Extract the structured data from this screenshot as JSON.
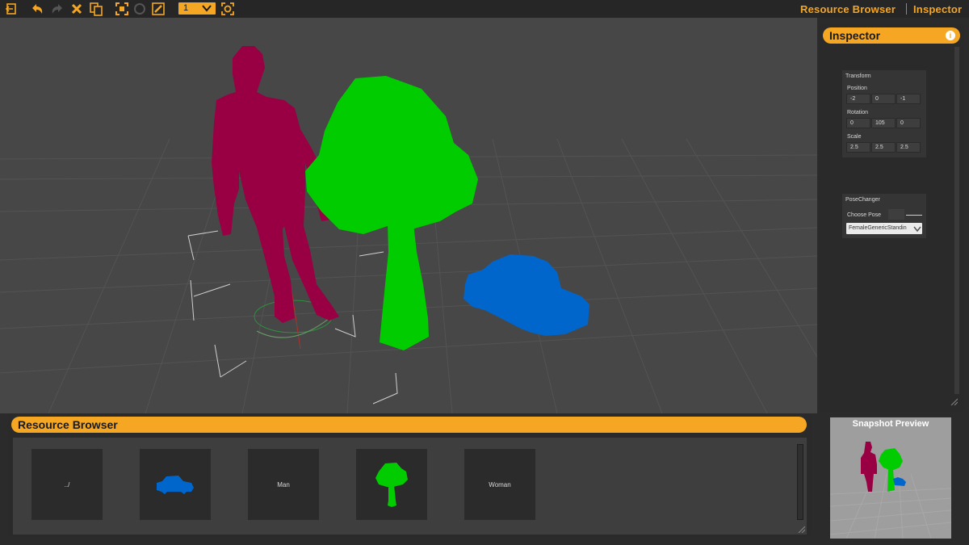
{
  "toolbar": {
    "selector_value": "1",
    "right_links": [
      "Resource Browser",
      "Inspector"
    ]
  },
  "inspector": {
    "title": "Inspector",
    "transform": {
      "title": "Transform",
      "position_label": "Position",
      "position": [
        "-2",
        "0",
        "-1"
      ],
      "rotation_label": "Rotation",
      "rotation": [
        "0",
        "105",
        "0"
      ],
      "scale_label": "Scale",
      "scale": [
        "2.5",
        "2.5",
        "2.5"
      ]
    },
    "pose_changer": {
      "title": "PoseChanger",
      "choose_label": "Choose Pose",
      "selected": "FemaleGenericStandin"
    }
  },
  "resource_browser": {
    "title": "Resource Browser",
    "items": [
      {
        "label": "../",
        "kind": "folder-up"
      },
      {
        "label": "",
        "kind": "car-thumbnail"
      },
      {
        "label": "Man",
        "kind": "text"
      },
      {
        "label": "",
        "kind": "tree-thumbnail"
      },
      {
        "label": "Woman",
        "kind": "text"
      }
    ]
  },
  "snapshot": {
    "title": "Snapshot Preview"
  },
  "colors": {
    "accent": "#f5a623",
    "figure": "#990044",
    "tree": "#00cc00",
    "car": "#0066cc",
    "viewport_bg": "#474747"
  }
}
